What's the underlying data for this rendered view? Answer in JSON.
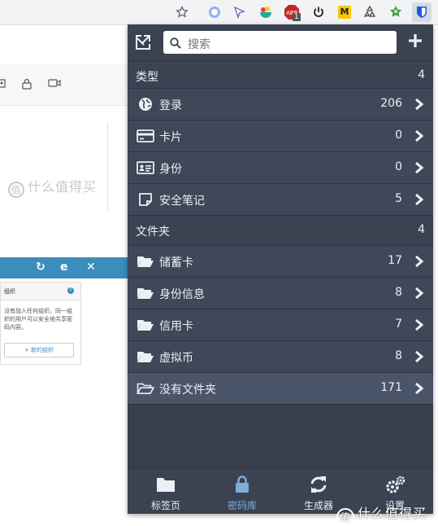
{
  "browser": {
    "toolbar_icons": [
      "star-icon",
      "extension-circle-icon",
      "extension-arrow-icon",
      "extension-bowl-icon",
      "adblock-icon",
      "power-icon",
      "extension-m-icon",
      "recycle-icon",
      "extension-leaf-icon",
      "bitwarden-icon"
    ],
    "adblock_badge": "1",
    "adblock_label": "ABP",
    "m_label": "M"
  },
  "background_page": {
    "watermark": "什么值得买",
    "card_title": "组织",
    "card_help": "?",
    "card_text": "没有加入任何组织。同一组织的用户可以安全地共享密码内容。",
    "card_button": "+ 新的组织"
  },
  "popup": {
    "search_placeholder": "搜索",
    "types_section": {
      "title": "类型",
      "count": "4"
    },
    "types": [
      {
        "label": "登录",
        "count": "206",
        "icon": "globe-icon"
      },
      {
        "label": "卡片",
        "count": "0",
        "icon": "credit-card-icon"
      },
      {
        "label": "身份",
        "count": "0",
        "icon": "id-card-icon"
      },
      {
        "label": "安全笔记",
        "count": "5",
        "icon": "note-icon"
      }
    ],
    "folders_section": {
      "title": "文件夹",
      "count": "4"
    },
    "folders": [
      {
        "label": "储蓄卡",
        "count": "17",
        "icon": "folder-open-icon"
      },
      {
        "label": "身份信息",
        "count": "8",
        "icon": "folder-open-icon"
      },
      {
        "label": "信用卡",
        "count": "7",
        "icon": "folder-open-icon"
      },
      {
        "label": "虚拟币",
        "count": "8",
        "icon": "folder-open-icon"
      },
      {
        "label": "没有文件夹",
        "count": "171",
        "icon": "folder-outline-icon"
      }
    ],
    "tabs": [
      {
        "label": "标签页",
        "icon": "folder-icon"
      },
      {
        "label": "密码库",
        "icon": "lock-icon",
        "active": true
      },
      {
        "label": "生成器",
        "icon": "refresh-icon"
      },
      {
        "label": "设置",
        "icon": "gears-icon"
      }
    ]
  },
  "watermark": "什么值得买",
  "colors": {
    "popup_bg": "#3b4252",
    "row_bg": "#3f4758",
    "row_selected": "#4b5569",
    "active_tab": "#7eafd9",
    "text": "#eceff4"
  }
}
